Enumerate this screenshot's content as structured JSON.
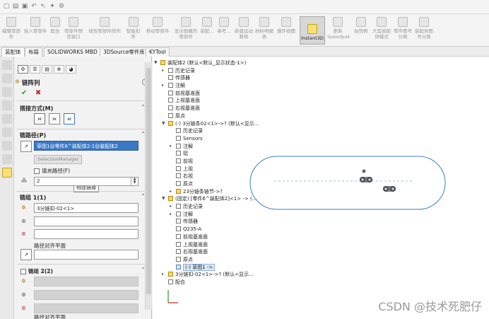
{
  "ribbon": {
    "buttons": [
      {
        "label": "编辑零部件"
      },
      {
        "label": "插入零部件"
      },
      {
        "label": "配合"
      },
      {
        "label": "零部件预览窗口"
      },
      {
        "label": "线性零部件阵列"
      },
      {
        "label": "智能扣件"
      },
      {
        "label": "移动零部件"
      },
      {
        "label": "显示隐藏的零部件"
      },
      {
        "label": "装配..."
      },
      {
        "label": "参考..."
      },
      {
        "label": "新建运动算例"
      },
      {
        "label": "材料明细表"
      },
      {
        "label": "爆炸视图"
      },
      {
        "label": "Instant3D"
      },
      {
        "label": "更新Speedpak"
      },
      {
        "label": "拍快照"
      },
      {
        "label": "大型装配体模式"
      },
      {
        "label": "零件图号分离"
      },
      {
        "label": "装配体图号分离"
      }
    ]
  },
  "tabs": [
    "装配体",
    "布局",
    "SOLIDWORKS MBD",
    "3DSource零件库",
    "KYTool"
  ],
  "panel": {
    "title": "链阵列",
    "help": "?",
    "ok": "✔",
    "cancel": "✖",
    "connection": {
      "header": "搭接方式(M)",
      "tooltip": "相连链接"
    },
    "path": {
      "header": "链路径(P)",
      "value": "草图1@零件6^装配体2-1@装配体2",
      "selection_manager": "SelectionManager",
      "fill_path": "填充路径(F)",
      "count": "2"
    },
    "group1": {
      "header": "链组 1(1)",
      "part": "3分链扣-02<1>",
      "path_align": "路径对齐平面"
    },
    "group2": {
      "header": "链组 2(2)",
      "path_align": "路径对齐平面"
    }
  },
  "tree": [
    {
      "indent": 0,
      "toggle": "▼",
      "icon": "y",
      "text": "装配体2 (默认<默认_显示状态-1>)"
    },
    {
      "indent": 1,
      "toggle": "▸",
      "icon": "",
      "text": "历史记录"
    },
    {
      "indent": 1,
      "toggle": "",
      "icon": "",
      "text": "传感器"
    },
    {
      "indent": 1,
      "toggle": "▸",
      "icon": "",
      "text": "注解"
    },
    {
      "indent": 1,
      "toggle": "",
      "icon": "",
      "text": "前视基准面"
    },
    {
      "indent": 1,
      "toggle": "",
      "icon": "",
      "text": "上视基准面"
    },
    {
      "indent": 1,
      "toggle": "",
      "icon": "",
      "text": "右视基准面"
    },
    {
      "indent": 1,
      "toggle": "",
      "icon": "",
      "text": "原点"
    },
    {
      "indent": 1,
      "toggle": "▼",
      "icon": "y",
      "text": "(-) 3分链条02<1>->? (默认<显示..."
    },
    {
      "indent": 2,
      "toggle": "",
      "icon": "",
      "text": "历史记录"
    },
    {
      "indent": 2,
      "toggle": "",
      "icon": "",
      "text": "Sensors"
    },
    {
      "indent": 2,
      "toggle": "▸",
      "icon": "",
      "text": "注解"
    },
    {
      "indent": 2,
      "toggle": "",
      "icon": "",
      "text": "铝"
    },
    {
      "indent": 2,
      "toggle": "",
      "icon": "",
      "text": "前视"
    },
    {
      "indent": 2,
      "toggle": "",
      "icon": "",
      "text": "上视"
    },
    {
      "indent": 2,
      "toggle": "",
      "icon": "",
      "text": "右视"
    },
    {
      "indent": 2,
      "toggle": "",
      "icon": "",
      "text": "原点"
    },
    {
      "indent": 2,
      "toggle": "▸",
      "icon": "y",
      "text": "23分链条链节->?"
    },
    {
      "indent": 1,
      "toggle": "▼",
      "icon": "y",
      "text": "(固定) [零件6^装配体2]<1> -> (..."
    },
    {
      "indent": 2,
      "toggle": "▸",
      "icon": "",
      "text": "历史记录"
    },
    {
      "indent": 2,
      "toggle": "▸",
      "icon": "",
      "text": "注解"
    },
    {
      "indent": 2,
      "toggle": "",
      "icon": "",
      "text": "传感器"
    },
    {
      "indent": 2,
      "toggle": "",
      "icon": "",
      "text": "Q235-A"
    },
    {
      "indent": 2,
      "toggle": "",
      "icon": "",
      "text": "前视基准面"
    },
    {
      "indent": 2,
      "toggle": "",
      "icon": "",
      "text": "上视基准面"
    },
    {
      "indent": 2,
      "toggle": "",
      "icon": "",
      "text": "右视基准面"
    },
    {
      "indent": 2,
      "toggle": "",
      "icon": "",
      "text": "原点"
    },
    {
      "indent": 2,
      "toggle": "",
      "icon": "b",
      "text": "(-) 草图1 ->",
      "highlight": true
    },
    {
      "indent": 1,
      "toggle": "▸",
      "icon": "y",
      "text": "3分链扣-02<1>->? (默认<显示..."
    },
    {
      "indent": 1,
      "toggle": "",
      "icon": "",
      "text": "配合"
    }
  ],
  "watermark": "CSDN @技术死肥仔"
}
